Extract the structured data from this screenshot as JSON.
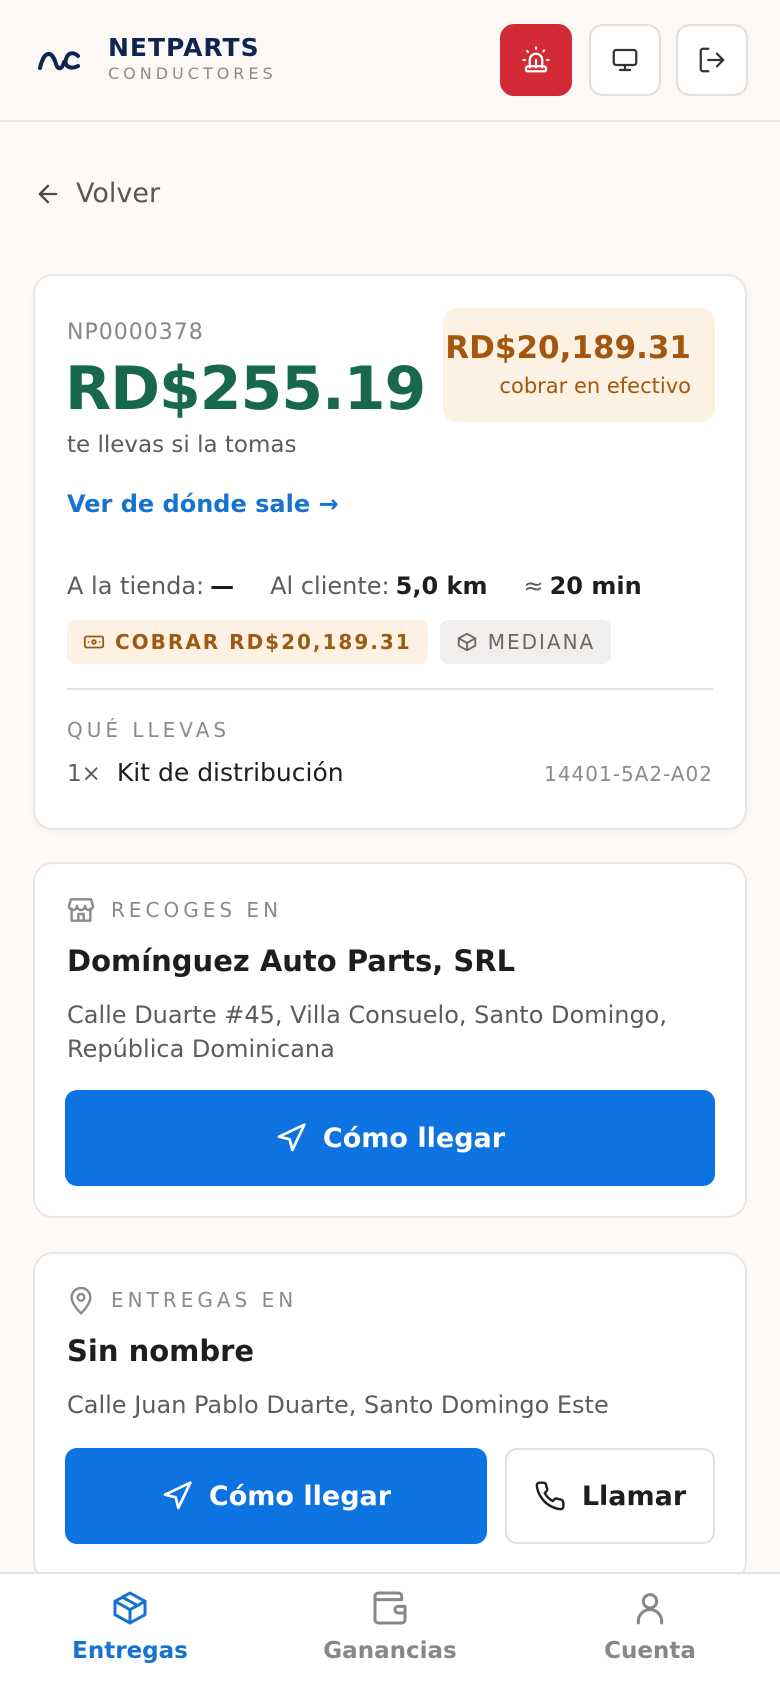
{
  "header": {
    "brand_name": "NETPARTS",
    "brand_sub": "CONDUCTORES",
    "alarm_icon": "siren-icon",
    "screen_icon": "monitor-icon",
    "logout_icon": "logout-icon"
  },
  "back": {
    "label": "Volver"
  },
  "order": {
    "id": "NP0000378",
    "earnings": "RD$255.19",
    "earnings_sub": "te llevas si la tomas",
    "cash_amount": "RD$20,189.31",
    "cash_label": "cobrar en efectivo",
    "origin_link": "Ver de dónde sale →",
    "to_store_label": "A la tienda:",
    "to_store_value": "—",
    "to_client_label": "Al cliente:",
    "to_client_value": "5,0 km",
    "time_prefix": "≈",
    "time_value": "20 min",
    "badge_cash": "COBRAR RD$20,189.31",
    "badge_size": "MEDIANA",
    "carry_label": "QUÉ LLEVAS",
    "item_qty": "1×",
    "item_name": "Kit de distribución",
    "item_code": "14401-5A2-A02"
  },
  "pickup": {
    "label": "RECOGES EN",
    "name": "Domínguez Auto Parts, SRL",
    "address": "Calle Duarte #45, Villa Consuelo, Santo Domingo, República Dominicana",
    "directions_label": "Cómo llegar"
  },
  "delivery": {
    "label": "ENTREGAS EN",
    "name": "Sin nombre",
    "address": "Calle Juan Pablo Duarte, Santo Domingo Este",
    "directions_label": "Cómo llegar",
    "call_label": "Llamar"
  },
  "nav": {
    "items": [
      {
        "label": "Entregas",
        "icon": "package-icon",
        "active": true
      },
      {
        "label": "Ganancias",
        "icon": "wallet-icon",
        "active": false
      },
      {
        "label": "Cuenta",
        "icon": "user-icon",
        "active": false
      }
    ]
  },
  "colors": {
    "primary": "#0c73e0",
    "earnings_green": "#17684e",
    "cash_brown": "#a2560e",
    "alarm_red": "#d22a36",
    "brand_navy": "#0d2550"
  }
}
